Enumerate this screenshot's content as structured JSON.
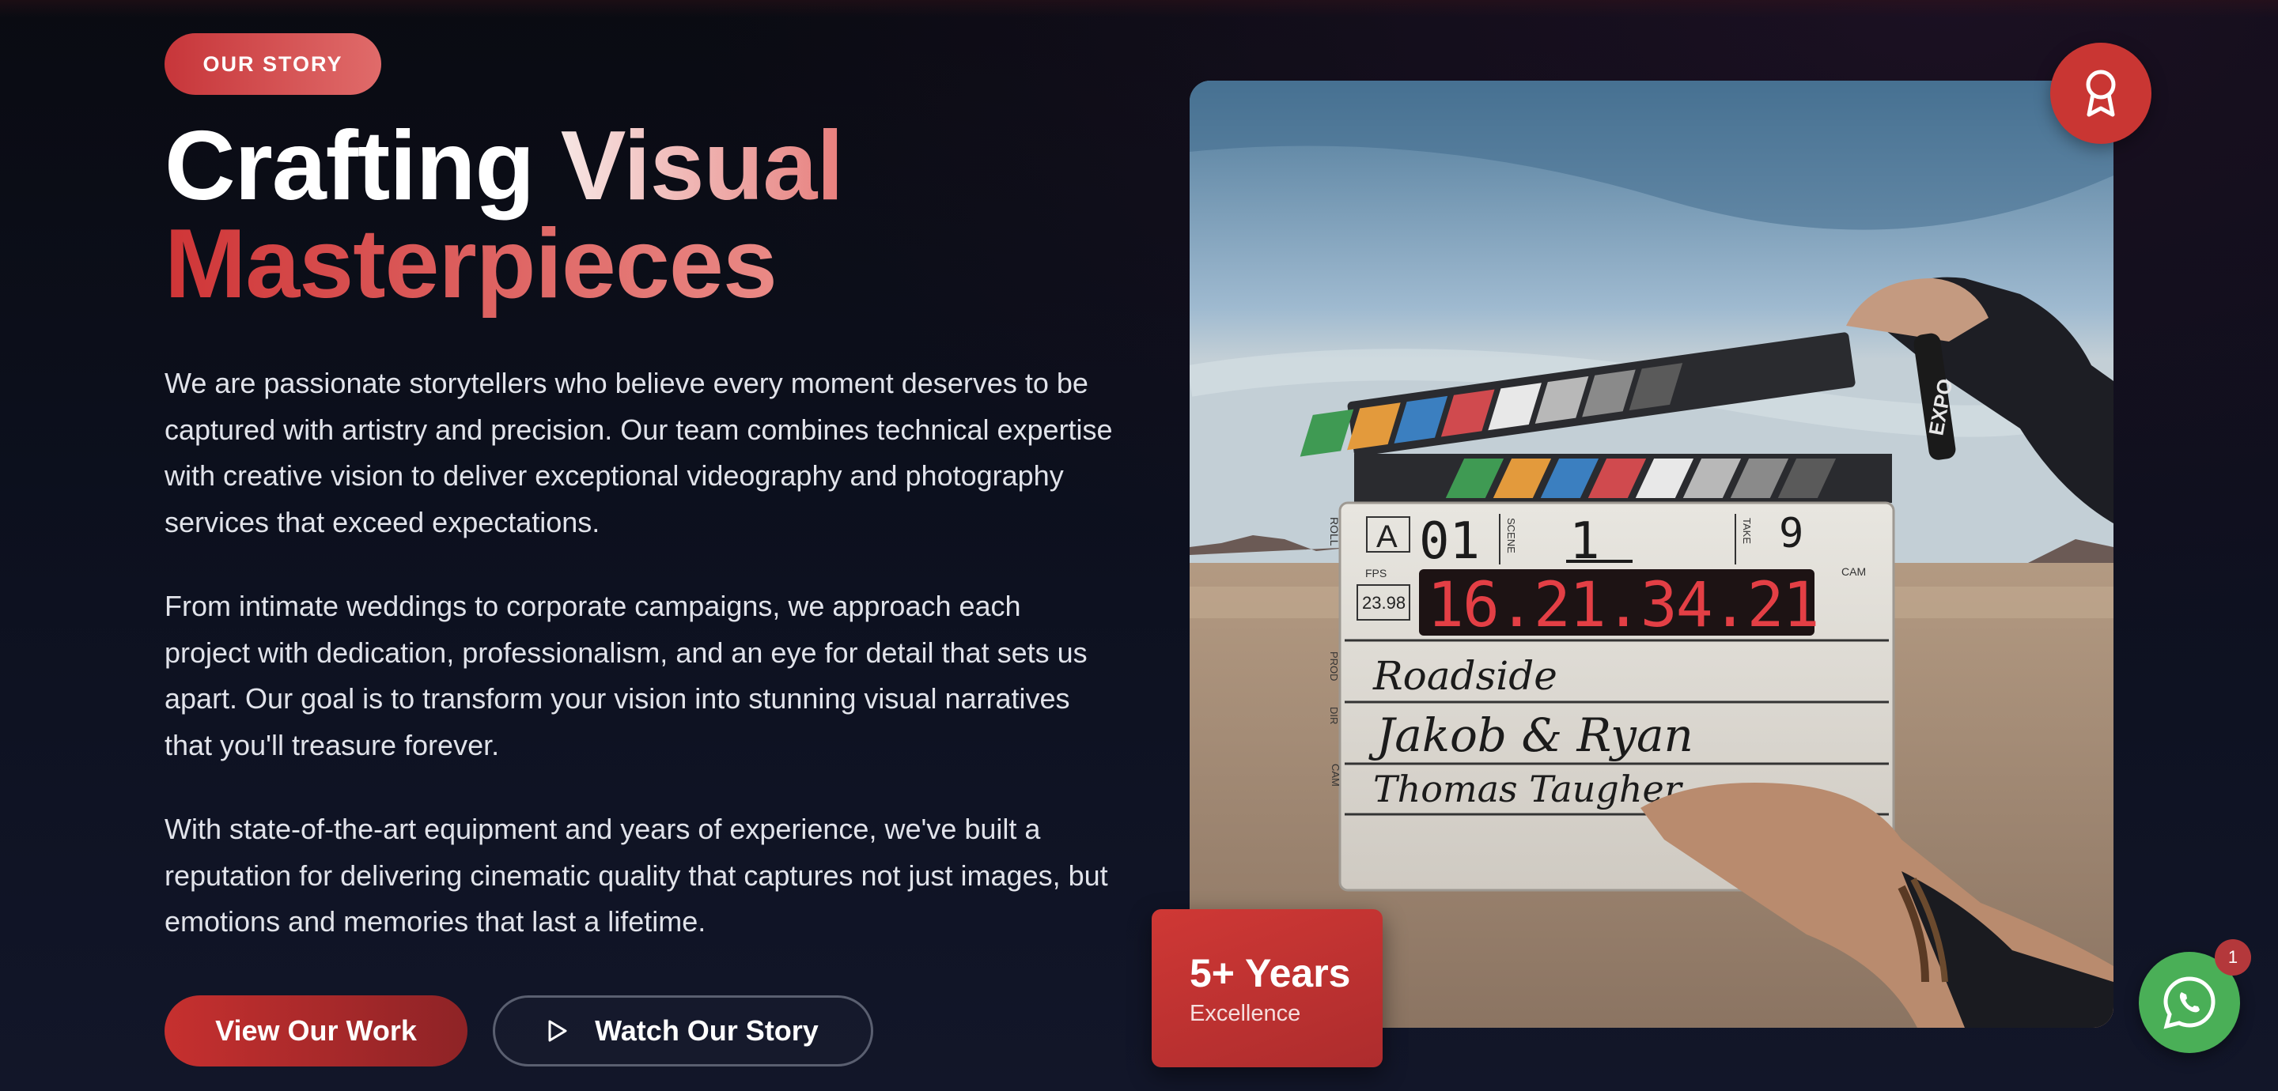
{
  "badge": {
    "label": "OUR STORY"
  },
  "heading": {
    "word1": "Crafting",
    "word2": "Visual",
    "word3": "Masterpieces"
  },
  "paragraphs": [
    "We are passionate storytellers who believe every moment deserves to be captured with artistry and precision. Our team combines technical expertise with creative vision to deliver exceptional videography and photography services that exceed expectations.",
    "From intimate weddings to corporate campaigns, we approach each project with dedication, professionalism, and an eye for detail that sets us apart. Our goal is to transform your vision into stunning visual narratives that you'll treasure forever.",
    "With state-of-the-art equipment and years of experience, we've built a reputation for delivering cinematic quality that captures not just images, but emotions and memories that last a lifetime."
  ],
  "buttons": {
    "primary": "View Our Work",
    "secondary": "Watch Our Story"
  },
  "stat": {
    "value": "5+ Years",
    "label": "Excellence"
  },
  "clapperboard": {
    "roll": "A",
    "roll_number": "01",
    "scene": "1",
    "take": "9",
    "fps": "23.98",
    "timecode": "16.21.34.21",
    "prod": "Roadside",
    "dir": "Jakob & Ryan",
    "cam": "Thomas Taugher",
    "field_roll": "ROLL",
    "field_scene": "SCENE",
    "field_take": "TAKE",
    "field_fps": "FPS",
    "field_cam_top": "CAM",
    "field_prod": "PROD",
    "field_dir": "DIR",
    "field_cam": "CAM",
    "marker": "EXPO"
  },
  "whatsapp": {
    "notification_count": "1"
  },
  "colors": {
    "accent": "#c93633",
    "whatsapp": "#4aaf57",
    "background": "#0b0d17"
  },
  "icons": {
    "award": "award-ribbon-icon",
    "play": "play-icon",
    "whatsapp": "whatsapp-icon"
  }
}
